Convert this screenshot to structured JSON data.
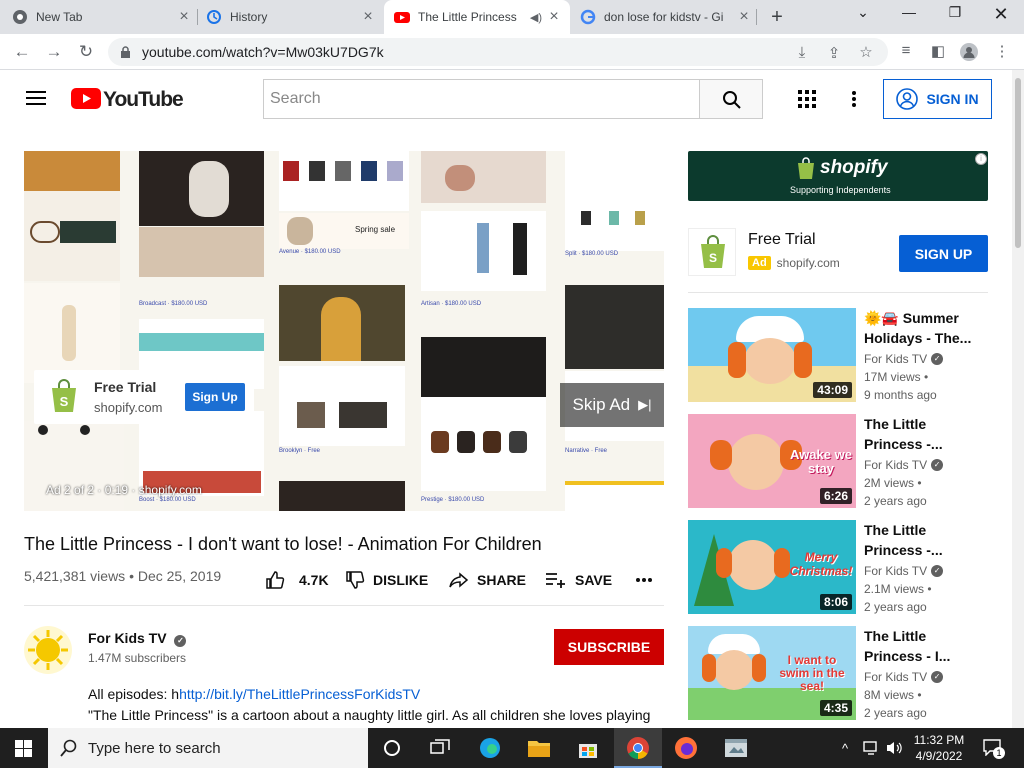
{
  "browser": {
    "tabs": [
      {
        "title": "New Tab",
        "icon": "chrome-icon"
      },
      {
        "title": "History",
        "icon": "history-icon"
      },
      {
        "title": "The Little Princess",
        "icon": "youtube-icon",
        "active": true
      },
      {
        "title": "don lose for kidstv - Gi",
        "icon": "google-icon"
      }
    ],
    "url": "youtube.com/watch?v=Mw03kU7DG7k"
  },
  "youtube": {
    "wordmark": "YouTube",
    "search_placeholder": "Search",
    "signin_label": "SIGN IN",
    "brand_color": "#ff0000"
  },
  "player": {
    "ad_card": {
      "title": "Free Trial",
      "domain": "shopify.com",
      "button": "Sign Up"
    },
    "skip_label": "Skip Ad",
    "ad_info": "Ad 2 of 2 · 0:19 · shopify.com",
    "product_labels": [
      "Broadcast",
      "Avenue",
      "Artisan",
      "Split",
      "Brooklyn",
      "Narrative",
      "Prestige",
      "Boost"
    ],
    "product_links": [
      "Broadcast · $180.00 USD",
      "Avenue · $180.00 USD",
      "Artisan · $180.00 USD",
      "Split · $180.00 USD",
      "Brooklyn · Free",
      "Narrative · Free",
      "Prestige · $180.00 USD",
      "Boost · $180.00 USD"
    ],
    "price_usd": "$180.00 USD",
    "spring_sale": "Spring sale"
  },
  "video": {
    "title": "The Little Princess - I don't want to lose! - Animation For Children",
    "meta": "5,421,381 views • Dec 25, 2019",
    "like_count": "4.7K",
    "dislike_label": "DISLIKE",
    "share_label": "SHARE",
    "save_label": "SAVE",
    "channel": "For Kids TV",
    "subscribers": "1.47M subscribers",
    "subscribe_label": "SUBSCRIBE",
    "desc_prefix": "All episodes: h",
    "desc_link": "http://bit.ly/TheLittlePrincessForKidsTV",
    "desc_line2": "\"The Little Princess\" is a cartoon about a naughty little girl. As all children she loves playing"
  },
  "sidebar": {
    "banner_brand": "shopify",
    "banner_tagline": "Supporting Independents",
    "ad_title": "Free Trial",
    "ad_badge": "Ad",
    "ad_domain": "shopify.com",
    "ad_button": "SIGN UP",
    "recs": [
      {
        "title": "🌞🚘 Summer Holidays - The...",
        "channel": "For Kids TV",
        "views": "17M views •",
        "age": "9 months ago",
        "duration": "43:09",
        "thumb_text": ""
      },
      {
        "title": "The Little Princess -...",
        "channel": "For Kids TV",
        "views": "2M views •",
        "age": "2 years ago",
        "duration": "6:26",
        "thumb_text": "Awake we stay"
      },
      {
        "title": "The Little Princess -...",
        "channel": "For Kids TV",
        "views": "2.1M views •",
        "age": "2 years ago",
        "duration": "8:06",
        "thumb_text": "Merry Christmas!"
      },
      {
        "title": "The Little Princess - I...",
        "channel": "For Kids TV",
        "views": "8M views •",
        "age": "2 years ago",
        "duration": "4:35",
        "thumb_text": "I want to swim in the sea!"
      }
    ]
  },
  "taskbar": {
    "search_placeholder": "Type here to search",
    "time": "11:32 PM",
    "date": "4/9/2022",
    "notif_count": "1"
  }
}
